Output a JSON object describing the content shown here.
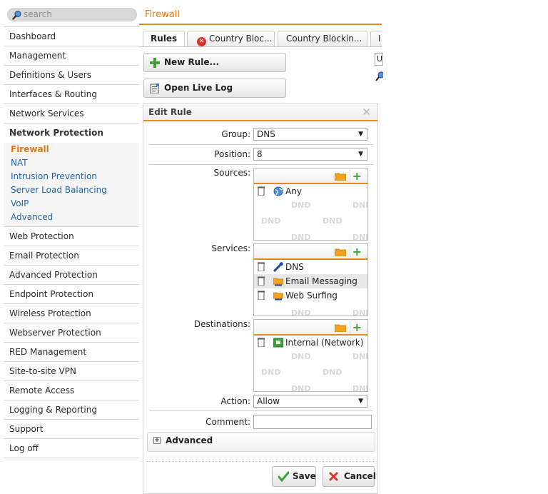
{
  "search": {
    "placeholder": "search"
  },
  "sidebar": {
    "top_items": [
      "Dashboard",
      "Management",
      "Definitions & Users",
      "Interfaces & Routing",
      "Network Services"
    ],
    "group": {
      "title": "Network Protection",
      "items": [
        "Firewall",
        "NAT",
        "Intrusion Prevention",
        "Server Load Balancing",
        "VoIP",
        "Advanced"
      ],
      "active": "Firewall"
    },
    "bottom_items": [
      "Web Protection",
      "Email Protection",
      "Advanced Protection",
      "Endpoint Protection",
      "Wireless Protection",
      "Webserver Protection",
      "RED Management",
      "Site-to-site VPN",
      "Remote Access",
      "Logging & Reporting",
      "Support",
      "Log off"
    ]
  },
  "header": {
    "title": "Firewall"
  },
  "tabs": [
    {
      "label": "Rules"
    },
    {
      "label": "Country Bloc..."
    },
    {
      "label": "Country Blockin..."
    },
    {
      "label": "I"
    }
  ],
  "actions": {
    "new_rule": "New Rule...",
    "open_live_log": "Open Live Log",
    "edge_field": "U"
  },
  "edit_rule": {
    "title": "Edit Rule",
    "close": "✕",
    "group": {
      "label": "Group:",
      "value": "DNS"
    },
    "position": {
      "label": "Position:",
      "value": "8"
    },
    "sources": {
      "label": "Sources:",
      "items": [
        "Any"
      ]
    },
    "services": {
      "label": "Services:",
      "items": [
        "DNS",
        "Email Messaging",
        "Web Surfing"
      ]
    },
    "destinations": {
      "label": "Destinations:",
      "items": [
        "Internal (Network)"
      ]
    },
    "dnd": "DND",
    "action": {
      "label": "Action:",
      "value": "Allow"
    },
    "comment": {
      "label": "Comment:",
      "value": ""
    },
    "advanced": "Advanced",
    "save": "Save",
    "cancel": "Cancel"
  },
  "colors": {
    "accent": "#e58a1f",
    "link": "#2264a8",
    "add": "#3ea23a",
    "cancel_x": "#d9342b"
  }
}
